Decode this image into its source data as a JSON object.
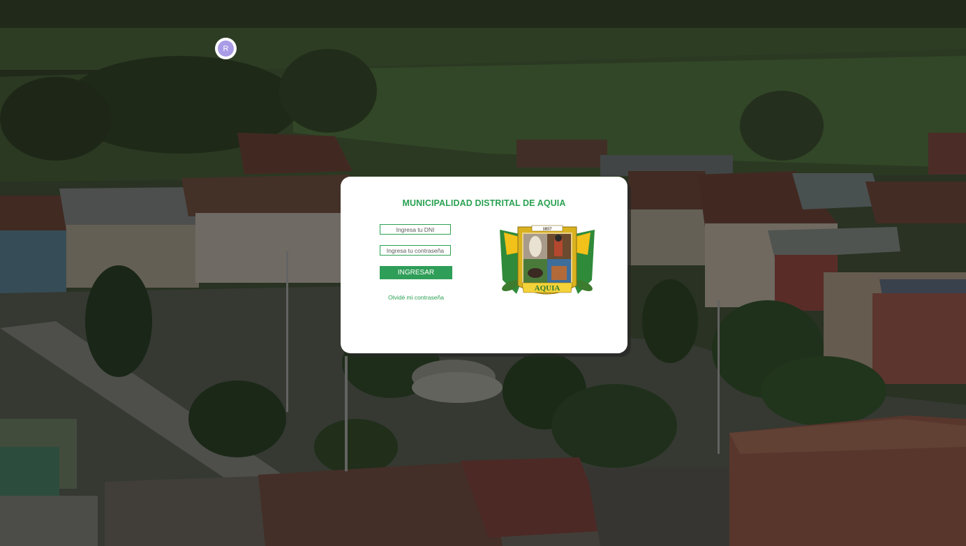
{
  "avatar": {
    "initial": "R"
  },
  "login": {
    "title": "MUNICIPALIDAD DISTRITAL DE AQUIA",
    "dni_placeholder": "Ingresa tu DNI",
    "dni_value": "",
    "password_placeholder": "Ingresa tu contraseña",
    "password_value": "",
    "submit_label": "INGRESAR",
    "forgot_label": "Olvidé mi contraseña"
  },
  "crest": {
    "year": "1857",
    "banner": "AQUIA"
  },
  "colors": {
    "brand_green": "#2aa152",
    "button_green": "#2f9e58",
    "avatar_purple": "#a99be6",
    "card_background": "#ffffff"
  },
  "icons": {
    "avatar": "user-avatar-icon",
    "crest": "municipal-coat-of-arms"
  }
}
